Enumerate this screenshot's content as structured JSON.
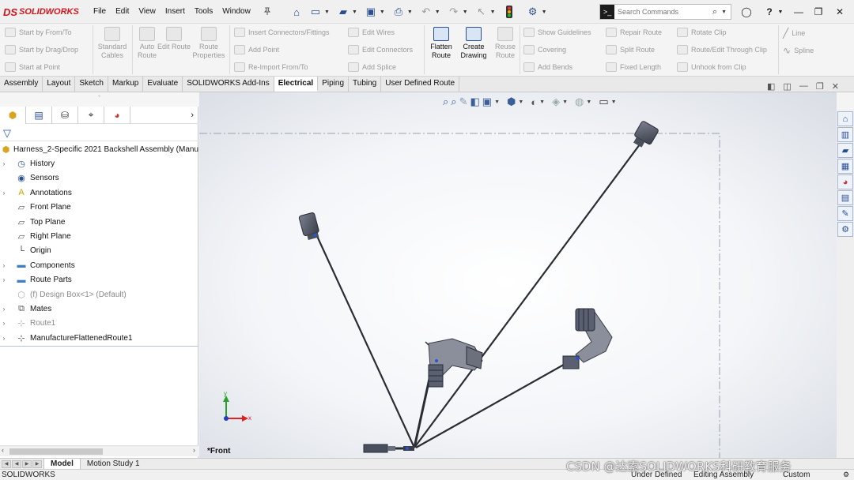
{
  "app": {
    "logo_mark": "DS",
    "logo_text": "SOLIDWORKS"
  },
  "menu": [
    "File",
    "Edit",
    "View",
    "Insert",
    "Tools",
    "Window"
  ],
  "search": {
    "placeholder": "Search Commands"
  },
  "ribbon": {
    "col1": [
      "Start by From/To",
      "Start by Drag/Drop",
      "Start at Point"
    ],
    "standard_cables": "Standard Cables",
    "auto_route": "Auto Route",
    "edit_route": "Edit Route",
    "route_properties": "Route Properties",
    "col_insert": [
      "Insert Connectors/Fittings",
      "Add Point",
      "Re-Import From/To"
    ],
    "col_wires": [
      "Edit Wires",
      "Edit Connectors",
      "Add Splice"
    ],
    "flatten_route": "Flatten Route",
    "create_drawing": "Create Drawing",
    "reuse_route": "Reuse Route",
    "col_guides": [
      "Show Guidelines",
      "Covering",
      "Add Bends"
    ],
    "col_repair": [
      "Repair Route",
      "Split Route",
      "Fixed Length"
    ],
    "col_clips": [
      "Rotate Clip",
      "Route/Edit Through Clip",
      "Unhook from Clip"
    ],
    "col_lines": [
      "Line",
      "Spline"
    ]
  },
  "tabs": [
    "Assembly",
    "Layout",
    "Sketch",
    "Markup",
    "Evaluate",
    "SOLIDWORKS Add-Ins",
    "Electrical",
    "Piping",
    "Tubing",
    "User Defined Route"
  ],
  "active_tab": "Electrical",
  "tree": {
    "root": "Harness_2-Specific 2021 Backshell Assembly  (Manu",
    "items": [
      "History",
      "Sensors",
      "Annotations",
      "Front Plane",
      "Top Plane",
      "Right Plane",
      "Origin",
      "Components",
      "Route Parts",
      "(f) Design Box<1> (Default)",
      "Mates",
      "Route1",
      "ManufactureFlattenedRoute1"
    ]
  },
  "viewport": {
    "view_label": "*Front",
    "triad_x": "x",
    "triad_y": "y"
  },
  "bottom_tabs": [
    "Model",
    "Motion Study 1"
  ],
  "status": {
    "app": "SOLIDWORKS",
    "defined": "Under Defined",
    "mode": "Editing Assembly",
    "units": "Custom"
  },
  "watermark": "CSDN @达索SOLIDWORKS科研教育服务",
  "colors": {
    "brand": "#d0161c",
    "accent": "#2c4f8f",
    "route": "#2a2d33"
  }
}
